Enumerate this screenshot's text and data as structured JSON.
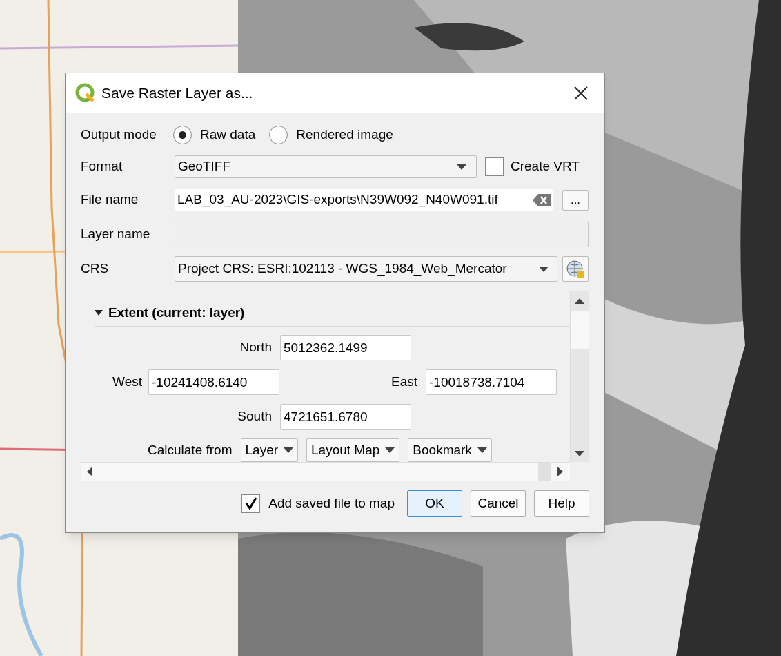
{
  "window": {
    "title": "Save Raster Layer as..."
  },
  "output_mode": {
    "label": "Output mode",
    "options": [
      {
        "label": "Raw data",
        "selected": true
      },
      {
        "label": "Rendered image",
        "selected": false
      }
    ]
  },
  "format": {
    "label": "Format",
    "value": "GeoTIFF",
    "create_vrt": {
      "label": "Create VRT",
      "checked": false
    }
  },
  "file_name": {
    "label": "File name",
    "value": "LAB_03_AU-2023\\GIS-exports\\N39W092_N40W091.tif",
    "browse": "..."
  },
  "layer_name": {
    "label": "Layer name",
    "disabled": true
  },
  "crs": {
    "label": "CRS",
    "value": "Project CRS: ESRI:102113 - WGS_1984_Web_Mercator"
  },
  "extent": {
    "title": "Extent (current: layer)",
    "expanded": true,
    "north": {
      "label": "North",
      "value": "5012362.1499"
    },
    "west": {
      "label": "West",
      "value": "-10241408.6140"
    },
    "east": {
      "label": "East",
      "value": "-10018738.7104"
    },
    "south": {
      "label": "South",
      "value": "4721651.6780"
    },
    "calculate_from": {
      "label": "Calculate from",
      "buttons": [
        "Layer",
        "Layout Map",
        "Bookmark"
      ]
    }
  },
  "add_to_map": {
    "label": "Add saved file to map",
    "checked": true
  },
  "buttons": [
    {
      "label": "OK",
      "default": true
    },
    {
      "label": "Cancel",
      "default": false
    },
    {
      "label": "Help",
      "default": false
    }
  ]
}
